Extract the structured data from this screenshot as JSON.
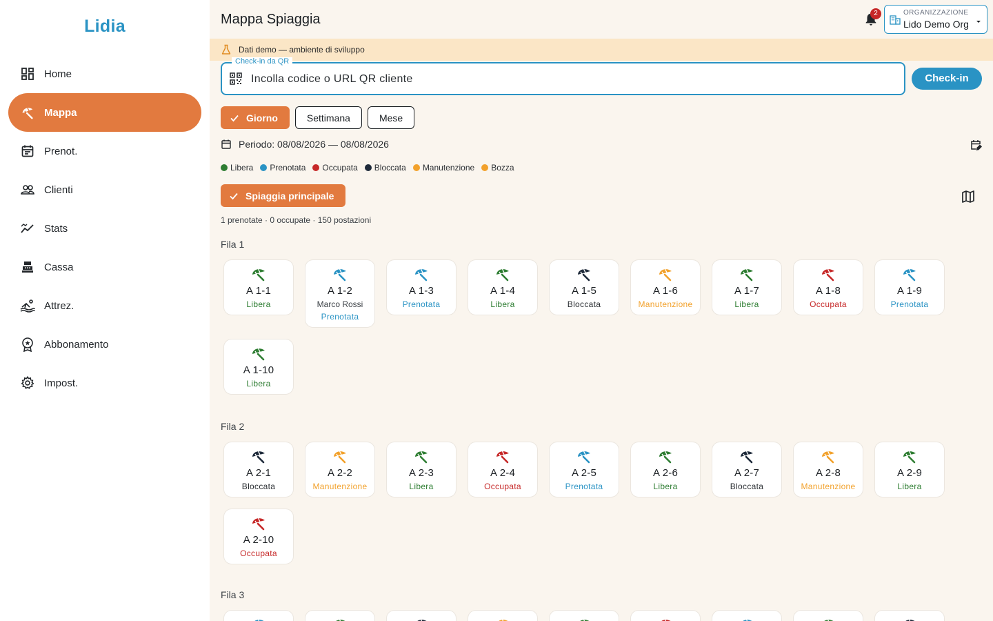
{
  "app": {
    "brand": "Lidia"
  },
  "colors": {
    "accent": "#e27a3f",
    "primary": "#2a93c4",
    "libera": "#2e7d32",
    "prenotata": "#2a93c4",
    "occupata": "#c62828",
    "bloccata": "#1e2a3a",
    "manutenzione": "#f2a12b",
    "bozza": "#f2a12b"
  },
  "sidebar": {
    "items": [
      {
        "label": "Home",
        "icon": "dashboard-icon"
      },
      {
        "label": "Mappa",
        "icon": "umbrella-icon",
        "active": true
      },
      {
        "label": "Prenot.",
        "icon": "calendar-icon"
      },
      {
        "label": "Clienti",
        "icon": "people-icon"
      },
      {
        "label": "Stats",
        "icon": "chart-icon"
      },
      {
        "label": "Cassa",
        "icon": "cash-register-icon"
      },
      {
        "label": "Attrez.",
        "icon": "deckchair-icon"
      },
      {
        "label": "Abbonamento",
        "icon": "badge-icon"
      },
      {
        "label": "Impost.",
        "icon": "gear-icon"
      }
    ]
  },
  "header": {
    "title": "Mappa Spiaggia",
    "notifications_count": "2",
    "org_label": "ORGANIZZAZIONE",
    "org_value": "Lido Demo Org"
  },
  "banner": {
    "text": "Dati demo — ambiente di sviluppo"
  },
  "checkin": {
    "legend": "Check-in da QR",
    "placeholder": "Incolla codice o URL QR cliente",
    "button": "Check-in"
  },
  "range": {
    "day": "Giorno",
    "week": "Settimana",
    "month": "Mese",
    "selected": "Giorno"
  },
  "period": "Periodo: 08/08/2026 — 08/08/2026",
  "legend": [
    {
      "label": "Libera",
      "color": "#2e7d32"
    },
    {
      "label": "Prenotata",
      "color": "#2a93c4"
    },
    {
      "label": "Occupata",
      "color": "#c62828"
    },
    {
      "label": "Bloccata",
      "color": "#1e2a3a"
    },
    {
      "label": "Manutenzione",
      "color": "#f2a12b"
    },
    {
      "label": "Bozza",
      "color": "#f2a12b"
    }
  ],
  "area": {
    "label": "Spiaggia principale"
  },
  "summary": "1 prenotate · 0 occupate · 150 postazioni",
  "rows": [
    {
      "label": "Fila 1",
      "spots": [
        {
          "code": "A 1-1",
          "status": "Libera"
        },
        {
          "code": "A 1-2",
          "client": "Marco Rossi",
          "status": "Prenotata"
        },
        {
          "code": "A 1-3",
          "status": "Prenotata"
        },
        {
          "code": "A 1-4",
          "status": "Libera"
        },
        {
          "code": "A 1-5",
          "status": "Bloccata"
        },
        {
          "code": "A 1-6",
          "status": "Manutenzione"
        },
        {
          "code": "A 1-7",
          "status": "Libera"
        },
        {
          "code": "A 1-8",
          "status": "Occupata"
        },
        {
          "code": "A 1-9",
          "status": "Prenotata"
        },
        {
          "code": "A 1-10",
          "status": "Libera"
        }
      ]
    },
    {
      "label": "Fila 2",
      "spots": [
        {
          "code": "A 2-1",
          "status": "Bloccata"
        },
        {
          "code": "A 2-2",
          "status": "Manutenzione"
        },
        {
          "code": "A 2-3",
          "status": "Libera"
        },
        {
          "code": "A 2-4",
          "status": "Occupata"
        },
        {
          "code": "A 2-5",
          "status": "Prenotata"
        },
        {
          "code": "A 2-6",
          "status": "Libera"
        },
        {
          "code": "A 2-7",
          "status": "Bloccata"
        },
        {
          "code": "A 2-8",
          "status": "Manutenzione"
        },
        {
          "code": "A 2-9",
          "status": "Libera"
        },
        {
          "code": "A 2-10",
          "status": "Occupata"
        }
      ]
    },
    {
      "label": "Fila 3",
      "spots": [
        {
          "umbrella_color": "prenotata"
        },
        {
          "umbrella_color": "libera"
        },
        {
          "umbrella_color": "bloccata"
        },
        {
          "umbrella_color": "manutenzione"
        },
        {
          "umbrella_color": "libera"
        },
        {
          "umbrella_color": "occupata"
        },
        {
          "umbrella_color": "prenotata"
        },
        {
          "umbrella_color": "libera"
        },
        {
          "umbrella_color": "bloccata"
        }
      ]
    }
  ]
}
